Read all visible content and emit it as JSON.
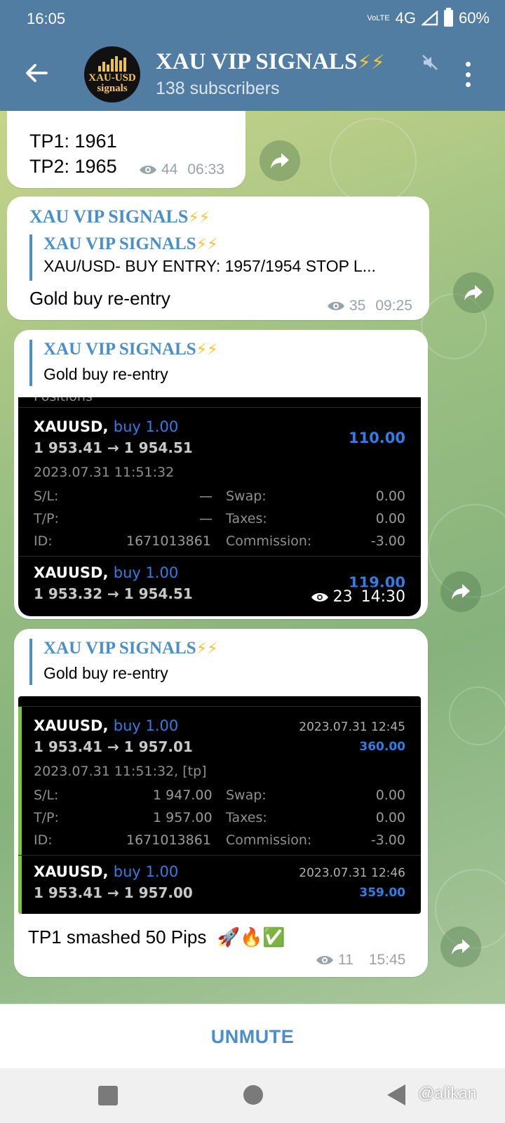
{
  "status_bar": {
    "time": "16:05",
    "network": "4G",
    "battery": "60%",
    "volte": "VoLTE"
  },
  "header": {
    "title": "XAU VIP SIGNALS",
    "title_emoji": "⚡⚡",
    "subtitle": "138 subscribers",
    "avatar_text_1": "XAU-USD",
    "avatar_text_2": "signals"
  },
  "messages": [
    {
      "lines": [
        "TP1: 1961",
        "TP2: 1965"
      ],
      "views": "44",
      "time": "06:33"
    },
    {
      "sender": "XAU VIP SIGNALS",
      "sender_emoji": "⚡⚡",
      "reply_sender": "XAU VIP SIGNALS",
      "reply_emoji": "⚡⚡",
      "reply_text": "XAU/USD-  BUY ENTRY: 1957/1954  STOP L...",
      "text": "Gold buy re-entry",
      "views": "35",
      "time": "09:25"
    },
    {
      "reply_sender": "XAU VIP SIGNALS",
      "reply_emoji": "⚡⚡",
      "reply_text": "Gold buy re-entry",
      "views": "23",
      "time": "14:30",
      "screenshot": {
        "cut_header": "Positions",
        "pos1_symbol": "XAUUSD,",
        "pos1_side": "buy 1.00",
        "pos1_prices": "1 953.41 → 1 954.51",
        "pos1_profit": "110.00",
        "pos1_datetime": "2023.07.31 11:51:32",
        "sl_label": "S/L:",
        "sl_value": "—",
        "tp_label": "T/P:",
        "tp_value": "—",
        "id_label": "ID:",
        "id_value": "1671013861",
        "swap_label": "Swap:",
        "swap_value": "0.00",
        "taxes_label": "Taxes:",
        "taxes_value": "0.00",
        "commission_label": "Commission:",
        "commission_value": "-3.00",
        "pos2_symbol": "XAUUSD,",
        "pos2_side": "buy 1.00",
        "pos2_prices": "1 953.32 → 1 954.51",
        "pos2_profit": "119.00"
      }
    },
    {
      "reply_sender": "XAU VIP SIGNALS",
      "reply_emoji": "⚡⚡",
      "reply_text": "Gold buy re-entry",
      "text": "TP1 smashed 50 Pips",
      "text_emoji": "🚀🔥✅",
      "views": "11",
      "time": "15:45",
      "screenshot": {
        "pos1_symbol": "XAUUSD,",
        "pos1_side": "buy 1.00",
        "pos1_close_time": "2023.07.31 12:45",
        "pos1_prices": "1 953.41 → 1 957.01",
        "pos1_profit": "360.00",
        "pos1_datetime": "2023.07.31 11:51:32, [tp]",
        "sl_label": "S/L:",
        "sl_value": "1 947.00",
        "tp_label": "T/P:",
        "tp_value": "1 957.00",
        "id_label": "ID:",
        "id_value": "1671013861",
        "swap_label": "Swap:",
        "swap_value": "0.00",
        "taxes_label": "Taxes:",
        "taxes_value": "0.00",
        "commission_label": "Commission:",
        "commission_value": "-3.00",
        "pos2_symbol": "XAUUSD,",
        "pos2_side": "buy 1.00",
        "pos2_close_time": "2023.07.31 12:46",
        "pos2_prices": "1 953.41 → 1 957.00",
        "pos2_profit": "359.00"
      }
    }
  ],
  "bottom": {
    "unmute_label": "UNMUTE"
  },
  "watermark": "@alikan",
  "colors": {
    "header_bg": "#517da2",
    "accent": "#4b8fc8",
    "bolt": "#f7c431",
    "profit_blue": "#2f7ee6"
  },
  "icons": [
    "back-arrow-icon",
    "mute-icon",
    "more-vert-icon",
    "eye-icon",
    "forward-icon"
  ]
}
